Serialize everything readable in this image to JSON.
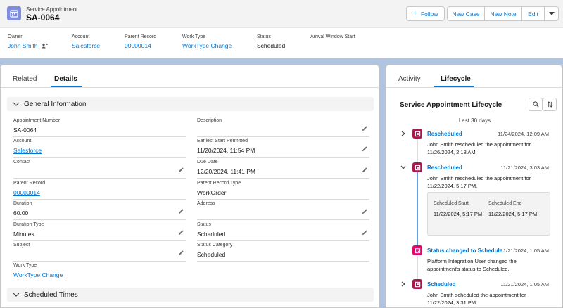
{
  "record": {
    "object_type": "Service Appointment",
    "name": "SA-0064"
  },
  "actions": {
    "follow": "Follow",
    "new_case": "New Case",
    "new_note": "New Note",
    "edit": "Edit"
  },
  "highlights": {
    "owner_label": "Owner",
    "owner_value": "John Smith",
    "account_label": "Account",
    "account_value": "Salesforce",
    "parent_label": "Parent Record",
    "parent_value": "00000014",
    "worktype_label": "Work Type",
    "worktype_value": "WorkType Change",
    "status_label": "Status",
    "status_value": "Scheduled",
    "arrival_label": "Arrival Window Start"
  },
  "left_tabs": {
    "related": "Related",
    "details": "Details"
  },
  "sections": {
    "general": "General Information",
    "scheduled": "Scheduled Times"
  },
  "fields": {
    "appointment_number": {
      "label": "Appointment Number",
      "value": "SA-0064"
    },
    "account": {
      "label": "Account",
      "value": "Salesforce"
    },
    "contact": {
      "label": "Contact",
      "value": ""
    },
    "parent_record": {
      "label": "Parent Record",
      "value": "00000014"
    },
    "duration": {
      "label": "Duration",
      "value": "60.00"
    },
    "duration_type": {
      "label": "Duration Type",
      "value": "Minutes"
    },
    "subject": {
      "label": "Subject",
      "value": ""
    },
    "work_type": {
      "label": "Work Type",
      "value": "WorkType Change"
    },
    "description": {
      "label": "Description",
      "value": ""
    },
    "earliest_start": {
      "label": "Earliest Start Permitted",
      "value": "11/20/2024, 11:54 PM"
    },
    "due_date": {
      "label": "Due Date",
      "value": "12/20/2024, 11:41 PM"
    },
    "parent_record_type": {
      "label": "Parent Record Type",
      "value": "WorkOrder"
    },
    "address": {
      "label": "Address",
      "value": ""
    },
    "status": {
      "label": "Status",
      "value": "Scheduled"
    },
    "status_category": {
      "label": "Status Category",
      "value": "Scheduled"
    }
  },
  "right_tabs": {
    "activity": "Activity",
    "lifecycle": "Lifecycle"
  },
  "lifecycle": {
    "title": "Service Appointment Lifecycle",
    "range": "Last 30 days",
    "items": [
      {
        "title": "Rescheduled",
        "date": "11/24/2024, 12:09 AM",
        "desc": "John Smith rescheduled the appointment for 11/26/2024, 2:18 AM."
      },
      {
        "title": "Rescheduled",
        "date": "11/21/2024, 3:03 AM",
        "desc": "John Smith rescheduled the appointment for 11/22/2024, 5:17 PM.",
        "detail": {
          "start_label": "Scheduled Start",
          "start_value": "11/22/2024, 5:17 PM",
          "end_label": "Scheduled End",
          "end_value": "11/22/2024, 5:17 PM"
        }
      },
      {
        "title": "Status changed to Schedule...",
        "date": "11/21/2024, 1:05 AM",
        "desc": "Platform Integration User changed the appointment's status to Scheduled."
      },
      {
        "title": "Scheduled",
        "date": "11/21/2024, 1:05 AM",
        "desc": "John Smith scheduled the appointment for 11/22/2024, 3:31 PM."
      }
    ]
  },
  "colors": {
    "accent": "#0176d3",
    "object_icon": "#7f8de1",
    "timeline_icon": "#a61a4f",
    "status_icon": "#e3066a",
    "background": "#b0c4df"
  }
}
